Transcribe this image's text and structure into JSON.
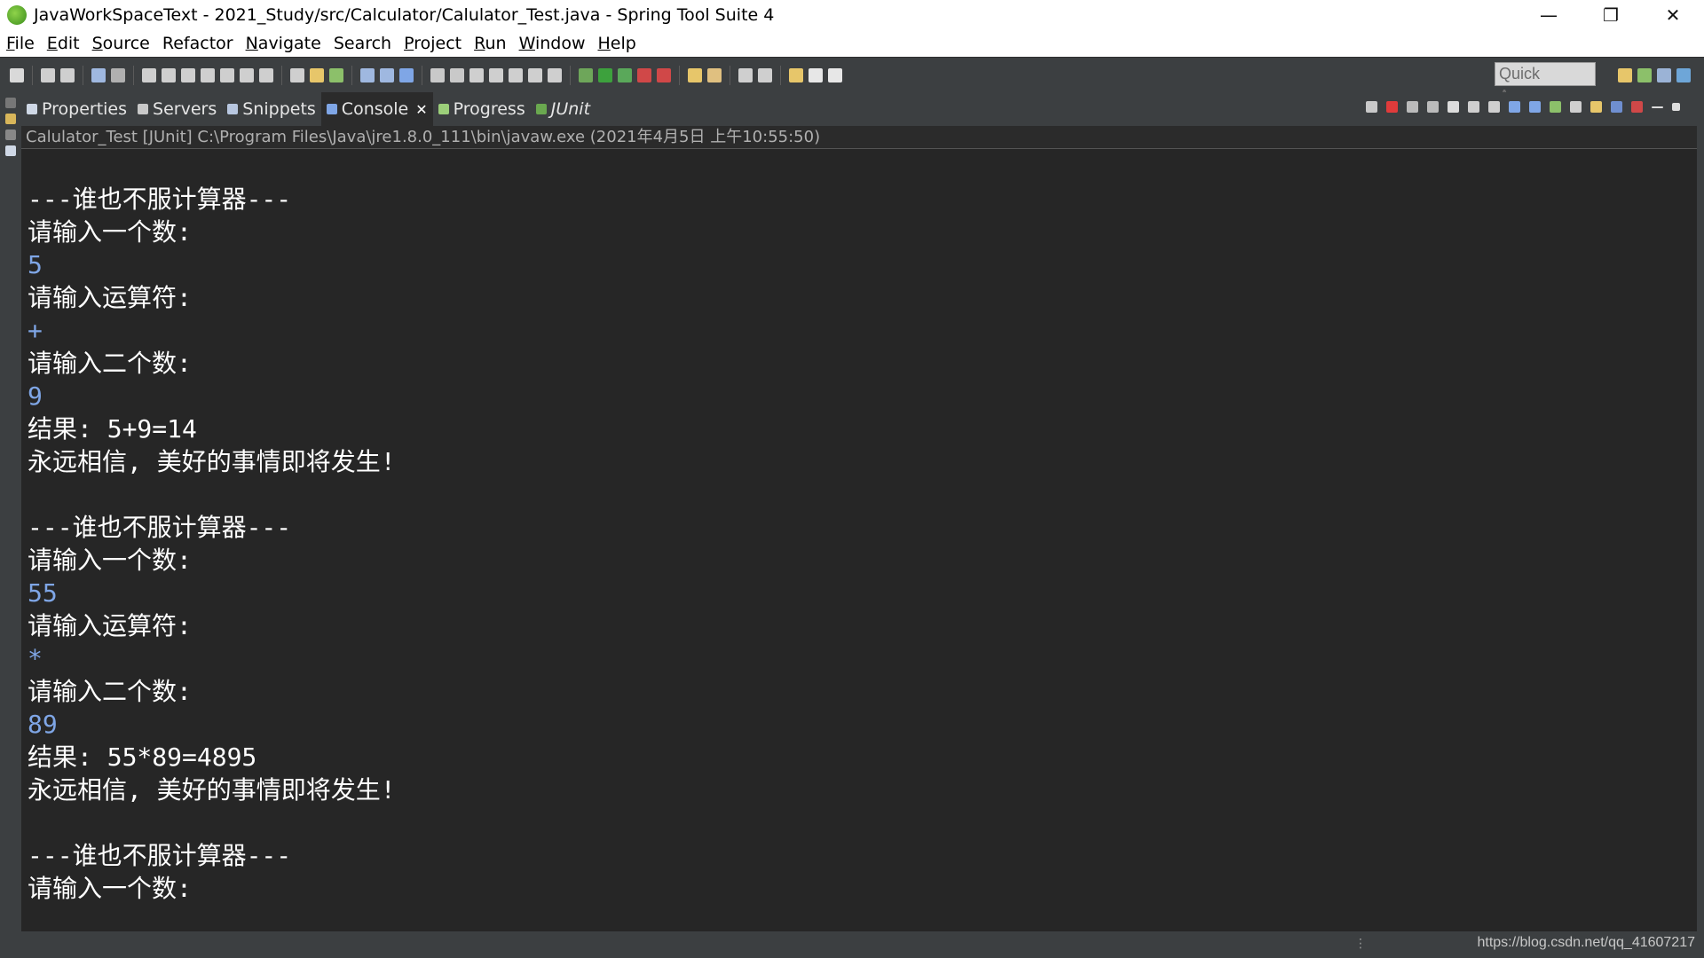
{
  "window": {
    "title": "JavaWorkSpaceText - 2021_Study/src/Calculator/Calulator_Test.java - Spring Tool Suite 4",
    "minimize_glyph": "—",
    "restore_glyph": "❐",
    "close_glyph": "✕"
  },
  "menu": {
    "items": [
      {
        "mn": "F",
        "rest": "ile"
      },
      {
        "mn": "E",
        "rest": "dit"
      },
      {
        "mn": "S",
        "rest": "ource"
      },
      {
        "mn": "",
        "rest": "Refactor"
      },
      {
        "mn": "N",
        "rest": "avigate"
      },
      {
        "mn": "",
        "rest": "Search"
      },
      {
        "mn": "P",
        "rest": "roject"
      },
      {
        "mn": "R",
        "rest": "un"
      },
      {
        "mn": "W",
        "rest": "indow"
      },
      {
        "mn": "H",
        "rest": "elp"
      }
    ]
  },
  "toolbar": {
    "quick_access": "Quick Access"
  },
  "views": {
    "tabs": [
      {
        "label": "Properties",
        "icon": "properties-icon",
        "color": "#cfd8e6"
      },
      {
        "label": "Servers",
        "icon": "servers-icon",
        "color": "#c9c9c9"
      },
      {
        "label": "Snippets",
        "icon": "snippets-icon",
        "color": "#b8c7e0"
      },
      {
        "label": "Console",
        "icon": "console-icon",
        "color": "#7fa6e6",
        "active": true
      },
      {
        "label": "Progress",
        "icon": "progress-icon",
        "color": "#9ccf7a"
      },
      {
        "label": "JUnit",
        "icon": "junit-icon",
        "color": "#6aa84f"
      }
    ],
    "close_glyph": "✕"
  },
  "console": {
    "description": "Calulator_Test [JUnit] C:\\Program Files\\Java\\jre1.8.0_111\\bin\\javaw.exe (2021年4月5日 上午10:55:50)",
    "lines": [
      {
        "text": "---谁也不服计算器---",
        "type": "out"
      },
      {
        "text": "请输入一个数:",
        "type": "out"
      },
      {
        "text": "5",
        "type": "in"
      },
      {
        "text": "请输入运算符:",
        "type": "out"
      },
      {
        "text": "+",
        "type": "in"
      },
      {
        "text": "请输入二个数:",
        "type": "out"
      },
      {
        "text": "9",
        "type": "in"
      },
      {
        "text": "结果: 5+9=14",
        "type": "out"
      },
      {
        "text": "永远相信, 美好的事情即将发生!",
        "type": "out"
      },
      {
        "text": "",
        "type": "out"
      },
      {
        "text": "---谁也不服计算器---",
        "type": "out"
      },
      {
        "text": "请输入一个数:",
        "type": "out"
      },
      {
        "text": "55",
        "type": "in"
      },
      {
        "text": "请输入运算符:",
        "type": "out"
      },
      {
        "text": "*",
        "type": "in"
      },
      {
        "text": "请输入二个数:",
        "type": "out"
      },
      {
        "text": "89",
        "type": "in"
      },
      {
        "text": "结果: 55*89=4895",
        "type": "out"
      },
      {
        "text": "永远相信, 美好的事情即将发生!",
        "type": "out"
      },
      {
        "text": "",
        "type": "out"
      },
      {
        "text": "---谁也不服计算器---",
        "type": "out"
      },
      {
        "text": "请输入一个数:",
        "type": "out"
      }
    ]
  },
  "status": {
    "watermark": "https://blog.csdn.net/qq_41607217"
  },
  "colors": {
    "console_bg": "#262626",
    "stdout": "#ffffff",
    "stdin": "#7fa6e6",
    "chrome_dark": "#3c3f41"
  }
}
